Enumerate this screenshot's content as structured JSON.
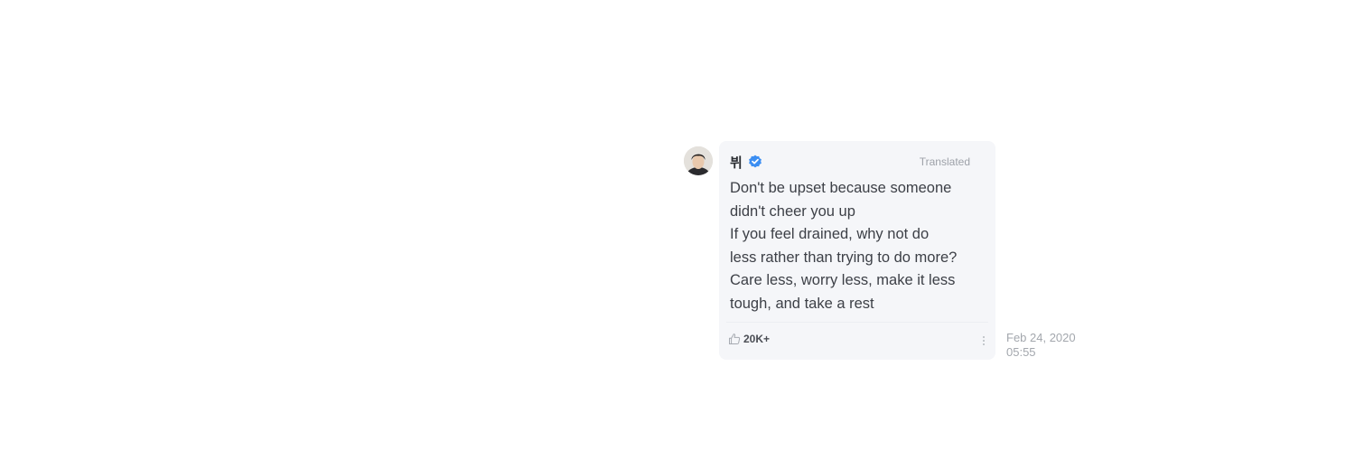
{
  "post": {
    "author": "뷔",
    "verified_icon": "verified-check-icon",
    "translated_label": "Translated",
    "message_lines": [
      "Don't be upset because someone",
      "didn't cheer you up",
      "If you feel drained, why not do",
      "less rather than trying to do more?",
      "Care less, worry less, make it less",
      "tough, and take a rest"
    ],
    "like_icon": "thumbs-up-icon",
    "like_count": "20K+",
    "more_icon": "more-vertical-icon",
    "date": "Feb 24, 2020",
    "time": "05:55"
  },
  "colors": {
    "bubble_bg": "#f5f6f9",
    "verified": "#3c8ef2",
    "muted_text": "#a3a7ad"
  }
}
